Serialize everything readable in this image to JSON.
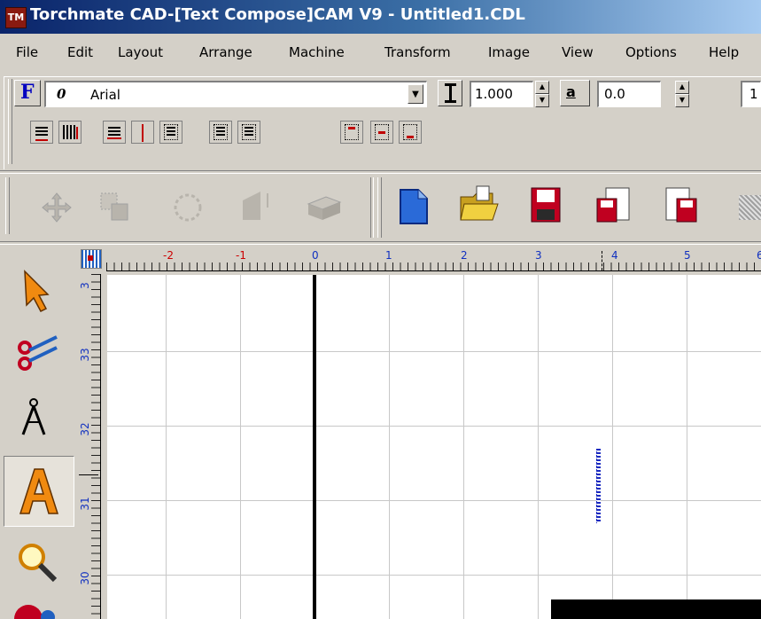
{
  "window": {
    "title": "Torchmate CAD-[Text Compose]CAM V9 - Untitled1.CDL",
    "app_icon_text": "TM"
  },
  "menu": [
    "File",
    "Edit",
    "Layout",
    "Arrange",
    "Machine",
    "Transform",
    "Image",
    "View",
    "Options",
    "Help"
  ],
  "font_toolbar": {
    "font_button_label": "F",
    "font_type_glyph": "0",
    "font_name": "Arial",
    "height_value": "1.000",
    "spacing_value": "0.0",
    "partial_value": "1"
  },
  "ruler": {
    "h_labels": [
      "-2",
      "-1",
      "0",
      "1",
      "2",
      "3",
      "4",
      "5",
      "6"
    ],
    "h_label_colors": [
      "#cc0000",
      "#cc0000",
      "#1030c0",
      "#1030c0",
      "#1030c0",
      "#1030c0",
      "#1030c0",
      "#1030c0",
      "#1030c0"
    ],
    "v_labels": [
      "3",
      "33",
      "32",
      "31",
      "30"
    ]
  },
  "tools": [
    "select-arrow",
    "scissors",
    "compass",
    "text-a",
    "zoom-magnifier",
    "red-ball"
  ],
  "colors": {
    "title_start": "#0a246a",
    "title_end": "#a6caf0",
    "grid": "#c8c8c8",
    "chrome": "#d4d0c8"
  }
}
